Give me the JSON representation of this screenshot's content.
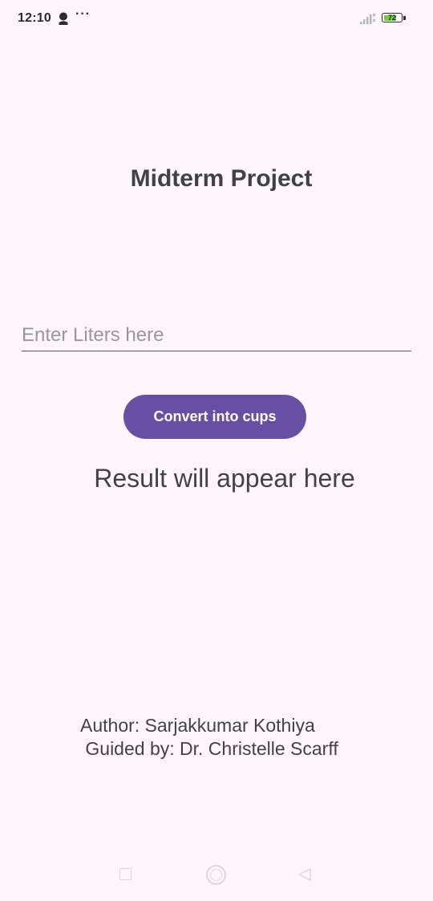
{
  "status_bar": {
    "time": "12:10",
    "user_icon": "person-icon",
    "more": "···",
    "signal_icon": "signal-icon",
    "battery_level": "72",
    "battery_fill_percent": 72,
    "battery_color": "#6fcf3a"
  },
  "app": {
    "title": "Midterm Project",
    "input_placeholder": "Enter Liters here",
    "input_value": "",
    "convert_label": "Convert into cups",
    "result_text": "Result will appear here",
    "author": "Author: Sarjakkumar Kothiya",
    "guided_by": " Guided by: Dr. Christelle Scarff",
    "accent_color": "#6750a4",
    "background_color": "#fdf7fc"
  },
  "nav_bar": {
    "recents_icon": "square-icon",
    "home_icon": "circle-home-icon",
    "back_icon": "triangle-back-icon"
  }
}
